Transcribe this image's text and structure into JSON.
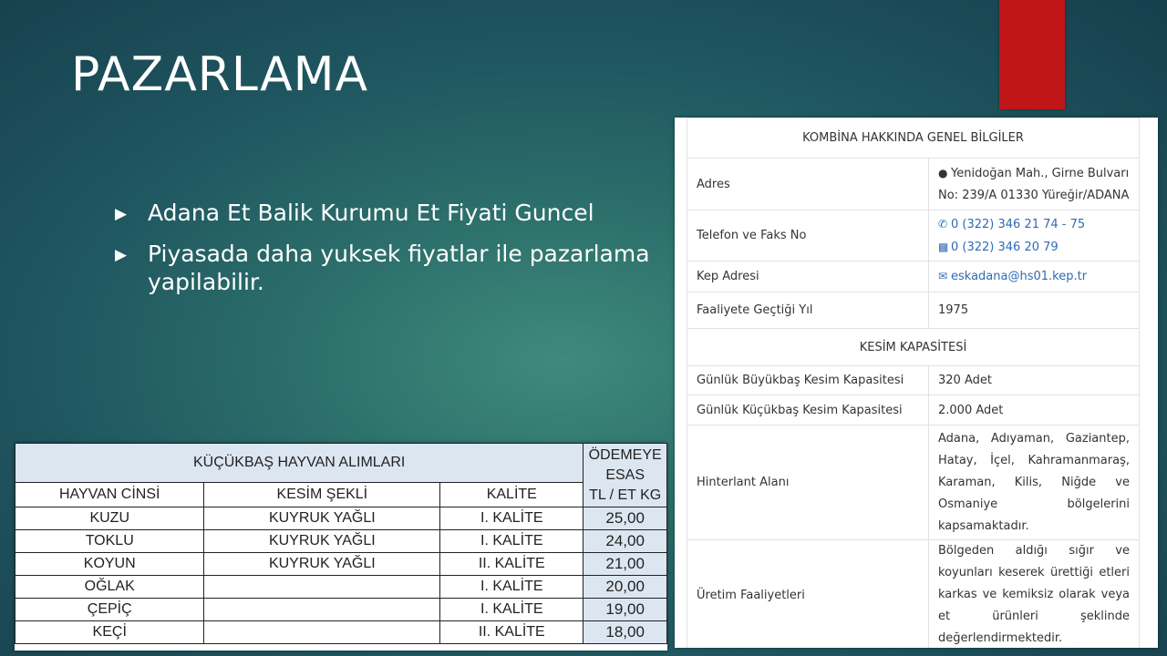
{
  "slide": {
    "title": "PAZARLAMA",
    "bullets": [
      "Adana Et Balik Kurumu Et Fiyati Guncel",
      "Piyasada daha yuksek fiyatlar ile pazarlama yapilabilir."
    ],
    "accent_color": "#c0161a"
  },
  "prices_table": {
    "header": "KÜÇÜKBAŞ HAYVAN ALIMLARI",
    "payment_header": [
      "ÖDEMEYE",
      "ESAS",
      "TL / ET KG"
    ],
    "columns": [
      "HAYVAN CİNSİ",
      "KESİM ŞEKLİ",
      "KALİTE"
    ],
    "rows": [
      {
        "animal": "KUZU",
        "cut": "KUYRUK YAĞLI",
        "quality": "I. KALİTE",
        "price": "25,00"
      },
      {
        "animal": "TOKLU",
        "cut": "KUYRUK YAĞLI",
        "quality": "I. KALİTE",
        "price": "24,00"
      },
      {
        "animal": "KOYUN",
        "cut": "KUYRUK YAĞLI",
        "quality": "II. KALİTE",
        "price": "21,00"
      },
      {
        "animal": "OĞLAK",
        "cut": "",
        "quality": "I. KALİTE",
        "price": "20,00"
      },
      {
        "animal": "ÇEPİÇ",
        "cut": "",
        "quality": "I. KALİTE",
        "price": "19,00"
      },
      {
        "animal": "KEÇİ",
        "cut": "",
        "quality": "II. KALİTE",
        "price": "18,00"
      }
    ]
  },
  "info_card": {
    "general_header": "KOMBİNA HAKKINDA GENEL BİLGİLER",
    "address_label": "Adres",
    "address_line1": "Yenidoğan Mah., Girne Bulvarı",
    "address_line2": "No: 239/A 01330 Yüreğir/ADANA",
    "phone_label": "Telefon ve Faks No",
    "phone": "0 (322) 346 21 74 - 75",
    "fax": "0 (322) 346 20 79",
    "kep_label": "Kep Adresi",
    "kep": "eskadana@hs01.kep.tr",
    "year_label": "Faaliyete Geçtiği Yıl",
    "year": "1975",
    "capacity_header": "KESİM KAPASİTESİ",
    "big_label": "Günlük Büyükbaş Kesim Kapasitesi",
    "big_value": "320 Adet",
    "small_label": "Günlük Küçükbaş Kesim Kapasitesi",
    "small_value": "2.000 Adet",
    "hinterland_label": "Hinterlant Alanı",
    "hinterland_value": "Adana, Adıyaman, Gaziantep, Hatay, İçel, Kahramanmaraş, Karaman, Kilis, Niğde ve Osmaniye bölgelerini kapsamaktadır.",
    "production_label": "Üretim Faaliyetleri",
    "production_value": "Bölgeden aldığı sığır ve koyunları keserek ürettiği etleri karkas ve kemiksiz olarak veya et ürünleri şeklinde değerlendirmektedir."
  },
  "icons": {
    "bullet": "triangle-right-icon",
    "address": "map-pin-icon",
    "phone": "phone-icon",
    "fax": "fax-icon",
    "email": "envelope-icon"
  }
}
